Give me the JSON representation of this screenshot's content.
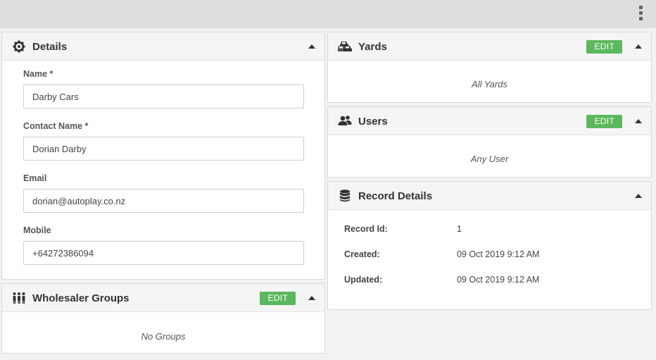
{
  "topbar": {
    "menu_icon": "kebab-menu-icon"
  },
  "details": {
    "title": "Details",
    "icon": "gear-icon",
    "fields": [
      {
        "label": "Name *",
        "value": "Darby Cars"
      },
      {
        "label": "Contact Name *",
        "value": "Dorian Darby"
      },
      {
        "label": "Email",
        "value": "dorian@autoplay.co.nz"
      },
      {
        "label": "Mobile",
        "value": "+64272386094"
      }
    ]
  },
  "groups": {
    "title": "Wholesaler Groups",
    "icon": "people-group-icon",
    "edit_label": "EDIT",
    "empty_text": "No Groups"
  },
  "yards": {
    "title": "Yards",
    "icon": "cars-icon",
    "edit_label": "EDIT",
    "empty_text": "All Yards"
  },
  "users": {
    "title": "Users",
    "icon": "users-icon",
    "edit_label": "EDIT",
    "empty_text": "Any User"
  },
  "record": {
    "title": "Record Details",
    "icon": "database-icon",
    "rows": [
      {
        "label": "Record Id:",
        "value": "1"
      },
      {
        "label": "Created:",
        "value": "09 Oct 2019 9:12 AM"
      },
      {
        "label": "Updated:",
        "value": "09 Oct 2019 9:12 AM"
      }
    ]
  },
  "colors": {
    "edit_button": "#5cb85c",
    "topbar": "#dedede",
    "background": "#f2f2f2"
  }
}
